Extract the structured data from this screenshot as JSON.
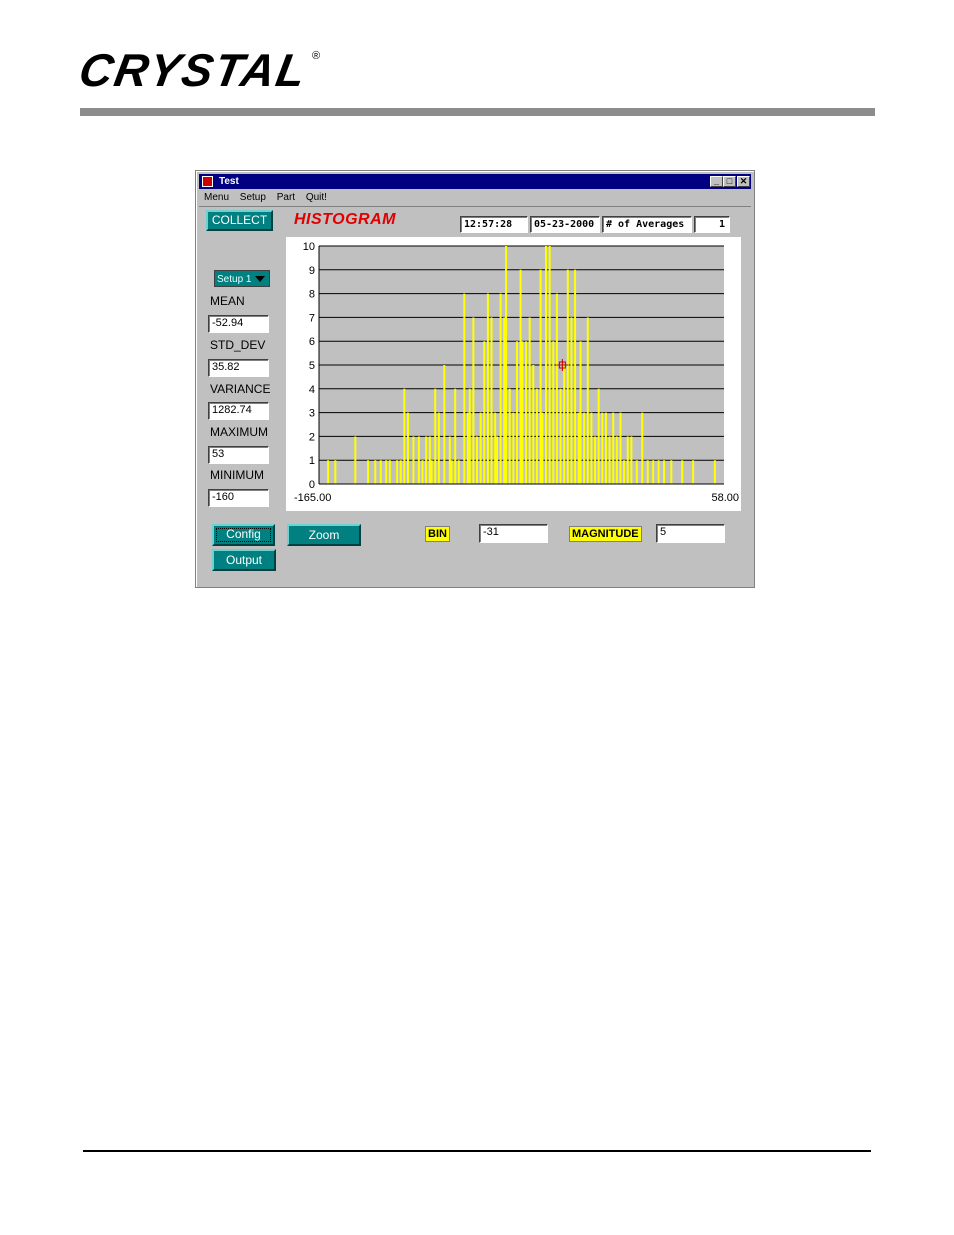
{
  "brand": {
    "logo_text": "CRYSTAL",
    "registered_mark": "®"
  },
  "window": {
    "title": "Test",
    "controls": {
      "minimize": "_",
      "maximize": "□",
      "close": "✕"
    },
    "menu": [
      "Menu",
      "Setup",
      "Part",
      "Quit!"
    ]
  },
  "toolbar": {
    "collect_label": "COLLECT",
    "histogram_title": "HISTOGRAM",
    "time": "12:57:28",
    "date": "05-23-2000",
    "averages_label": "# of Averages",
    "averages_value": "1"
  },
  "setup_select": {
    "value": "Setup 1"
  },
  "stats": [
    {
      "label": "MEAN",
      "value": "-52.94"
    },
    {
      "label": "STD_DEV",
      "value": "35.82"
    },
    {
      "label": "VARIANCE",
      "value": "1282.74"
    },
    {
      "label": "MAXIMUM",
      "value": "53"
    },
    {
      "label": "MINIMUM",
      "value": "-160"
    }
  ],
  "buttons": {
    "config": "Config",
    "output": "Output",
    "zoom": "Zoom"
  },
  "readout": {
    "bin_label": "BIN",
    "bin_value": "-31",
    "magnitude_label": "MAGNITUDE",
    "magnitude_value": "5"
  },
  "colors": {
    "bars": "#ffff00",
    "teal": "#008080",
    "title_red": "#e00000",
    "titlebar": "#000080"
  },
  "chart_data": {
    "type": "bar",
    "title": "HISTOGRAM",
    "xlim": [
      -165,
      58
    ],
    "ylim": [
      0,
      10
    ],
    "x_tick_labels": [
      "-165.00",
      "58.00"
    ],
    "y_ticks": [
      "0",
      "1",
      "2",
      "3",
      "4",
      "5",
      "6",
      "7",
      "8",
      "9",
      "10"
    ],
    "grid": true,
    "cursor": {
      "x": -31,
      "y": 5
    },
    "series": [
      {
        "x": [
          -160,
          -156,
          -145,
          -138,
          -134,
          -131,
          -128,
          -126,
          -122,
          -120,
          -118,
          -116,
          -113,
          -110,
          -108,
          -106,
          -104,
          -103,
          -101,
          -99,
          -96,
          -93,
          -92,
          -90,
          -88,
          -85,
          -83,
          -82,
          -80,
          -78,
          -76,
          -74,
          -72,
          -70,
          -68,
          -67,
          -65,
          -63,
          -62,
          -60,
          -58,
          -56,
          -54,
          -53,
          -51,
          -49,
          -47,
          -45,
          -43,
          -42,
          -40,
          -38,
          -36,
          -34,
          -32,
          -30,
          -28,
          -26,
          -24,
          -22,
          -21,
          -19,
          -17,
          -15,
          -13,
          -11,
          -9,
          -7,
          -5,
          -3,
          -1,
          1,
          3,
          5,
          7,
          10,
          13,
          16,
          19,
          22,
          25,
          29,
          35,
          41,
          53
        ],
        "values": [
          1,
          1,
          2,
          1,
          1,
          1,
          1,
          1,
          1,
          1,
          4,
          3,
          2,
          2,
          1,
          2,
          2,
          1,
          4,
          3,
          5,
          2,
          1,
          4,
          1,
          8,
          3,
          4,
          7,
          2,
          3,
          6,
          8,
          7,
          3,
          2,
          8,
          7,
          10,
          4,
          3,
          6,
          9,
          6,
          6,
          7,
          5,
          4,
          9,
          3,
          10,
          10,
          6,
          8,
          4,
          5,
          9,
          7,
          9,
          3,
          6,
          3,
          7,
          3,
          2,
          4,
          3,
          3,
          2,
          3,
          2,
          3,
          1,
          2,
          2,
          1,
          3,
          1,
          1,
          1,
          1,
          1,
          1,
          1,
          1
        ]
      }
    ]
  }
}
